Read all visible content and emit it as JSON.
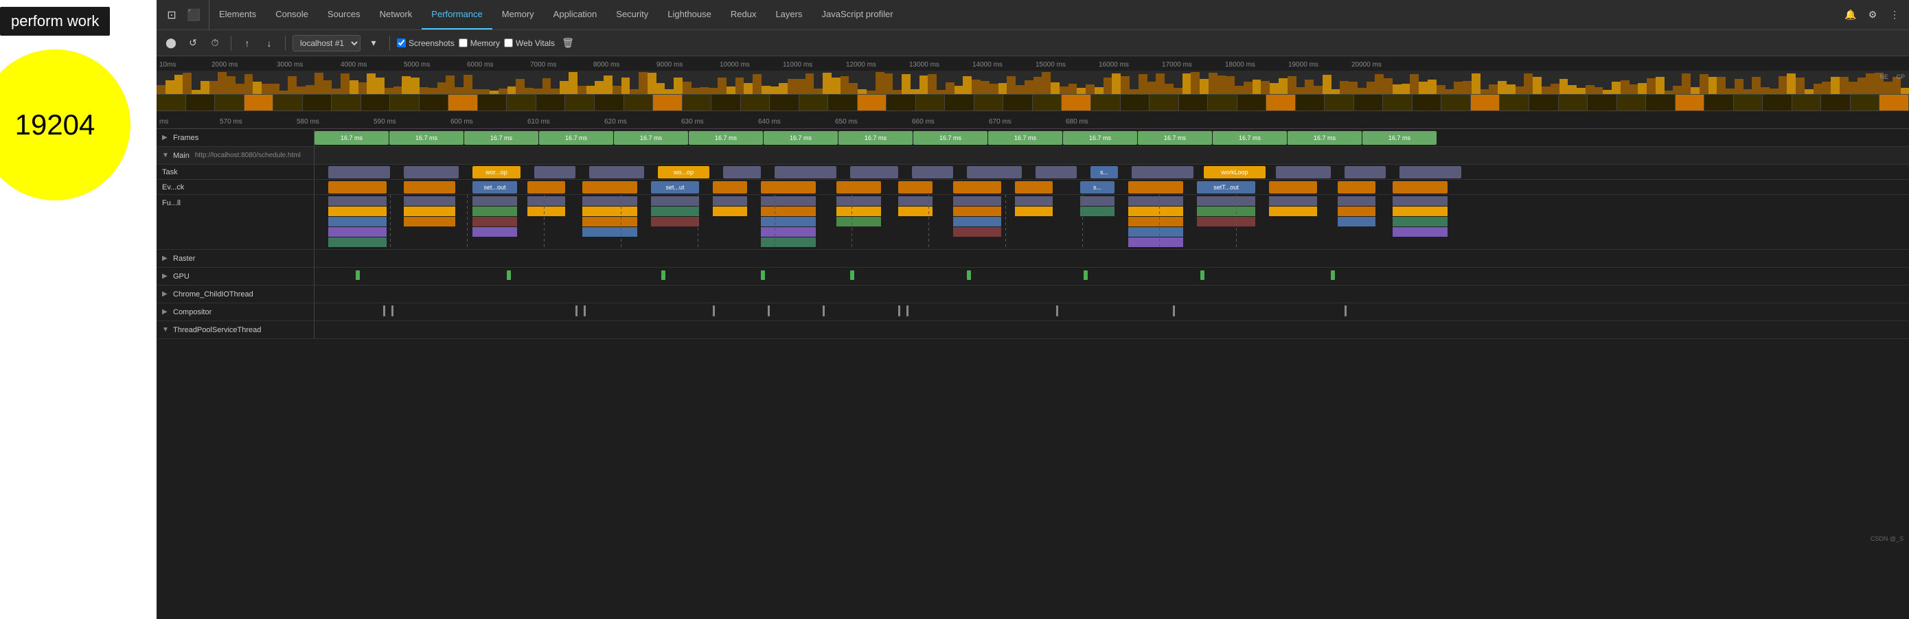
{
  "webpage": {
    "title": "perform work",
    "circle_number": "19204"
  },
  "devtools": {
    "tabs": [
      {
        "label": "Elements",
        "active": false
      },
      {
        "label": "Console",
        "active": false
      },
      {
        "label": "Sources",
        "active": false
      },
      {
        "label": "Network",
        "active": false
      },
      {
        "label": "Performance",
        "active": true
      },
      {
        "label": "Memory",
        "active": false
      },
      {
        "label": "Application",
        "active": false
      },
      {
        "label": "Security",
        "active": false
      },
      {
        "label": "Lighthouse",
        "active": false
      },
      {
        "label": "Redux",
        "active": false
      },
      {
        "label": "Layers",
        "active": false
      },
      {
        "label": "JavaScript profiler",
        "active": false
      }
    ],
    "toolbar": {
      "target": "localhost #1",
      "screenshots_label": "Screenshots",
      "memory_label": "Memory",
      "web_vitals_label": "Web Vitals"
    },
    "ruler": {
      "ticks": [
        "10ms",
        "2000 ms",
        "3000 ms",
        "4000 ms",
        "5000 ms",
        "6000 ms",
        "7000 ms",
        "8000 ms",
        "9000 ms",
        "10000 ms",
        "11000 ms",
        "12000 ms",
        "13000 ms",
        "14000 ms",
        "15000 ms",
        "16000 ms",
        "17000 ms",
        "18000 ms",
        "19000 ms",
        "20000 ms"
      ]
    },
    "detail_ruler": {
      "ticks": [
        "ms",
        "570 ms",
        "580 ms",
        "590 ms",
        "600 ms",
        "610 ms",
        "620 ms",
        "630 ms",
        "640 ms",
        "650 ms",
        "660 ms",
        "670 ms",
        "680 ms"
      ]
    },
    "tracks": {
      "frames_label": "Frames",
      "frames_value": "16.7 ms",
      "main_label": "Main",
      "main_url": "http://localhost:8080/schedule.html",
      "task_label": "Task",
      "ev_ck_label": "Ev...ck",
      "fu_ll_label": "Fu...ll",
      "raster_label": "Raster",
      "gpu_label": "GPU",
      "chrome_child_label": "Chrome_ChildIOThread",
      "compositor_label": "Compositor",
      "thread_pool_label": "ThreadPoolServiceThread"
    },
    "task_blocks": [
      {
        "label": "wor...op",
        "type": "yellow"
      },
      {
        "label": "set...out",
        "type": "blue"
      },
      {
        "label": "wo...op",
        "type": "yellow"
      },
      {
        "label": "set...ut",
        "type": "blue"
      },
      {
        "label": "workLoop",
        "type": "yellow"
      },
      {
        "label": "setT...out",
        "type": "blue"
      },
      {
        "label": "s...",
        "type": "blue"
      }
    ],
    "credits": "CSDN @_S"
  }
}
